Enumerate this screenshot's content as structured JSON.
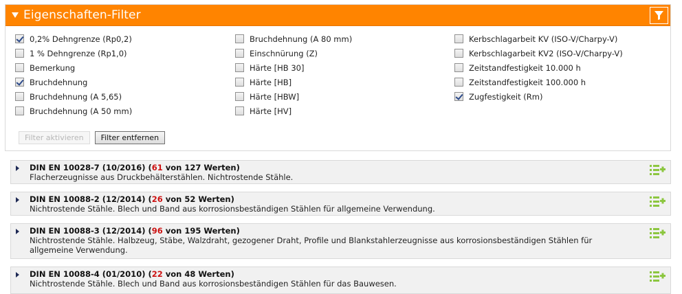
{
  "panel": {
    "title": "Eigenschaften-Filter",
    "icons": {
      "toggle": "triangle-down-icon",
      "filter": "funnel-icon"
    },
    "colors": {
      "header": "#ff8400",
      "highlight": "#cc1111",
      "add_icon": "#8cc63f"
    }
  },
  "columns": [
    [
      {
        "label": "0,2% Dehngrenze (Rp0,2)",
        "checked": true
      },
      {
        "label": "1 % Dehngrenze (Rp1,0)",
        "checked": false
      },
      {
        "label": "Bemerkung",
        "checked": false
      },
      {
        "label": "Bruchdehnung",
        "checked": true
      },
      {
        "label": "Bruchdehnung (A 5,65)",
        "checked": false
      },
      {
        "label": "Bruchdehnung (A 50 mm)",
        "checked": false
      }
    ],
    [
      {
        "label": "Bruchdehnung (A 80 mm)",
        "checked": false
      },
      {
        "label": "Einschnürung (Z)",
        "checked": false
      },
      {
        "label": "Härte [HB 30]",
        "checked": false
      },
      {
        "label": "Härte [HB]",
        "checked": false
      },
      {
        "label": "Härte [HBW]",
        "checked": false
      },
      {
        "label": "Härte [HV]",
        "checked": false
      }
    ],
    [
      {
        "label": "Kerbschlagarbeit KV (ISO-V/Charpy-V)",
        "checked": false
      },
      {
        "label": "Kerbschlagarbeit KV2 (ISO-V/Charpy-V)",
        "checked": false
      },
      {
        "label": "Zeitstandfestigkeit 10.000 h",
        "checked": false
      },
      {
        "label": "Zeitstandfestigkeit 100.000 h",
        "checked": false
      },
      {
        "label": "Zugfestigkeit (Rm)",
        "checked": true
      }
    ]
  ],
  "buttons": {
    "activate": "Filter aktivieren",
    "remove": "Filter entfernen"
  },
  "results": [
    {
      "title": "DIN EN 10028-7 (10/2016) (",
      "count": "61",
      "rest": " von 127 Werten)",
      "desc": "Flacherzeugnisse aus Druckbehälterstählen. Nichtrostende Stähle."
    },
    {
      "title": "DIN EN 10088-2 (12/2014) (",
      "count": "26",
      "rest": " von 52 Werten)",
      "desc": "Nichtrostende Stähle. Blech und Band aus korrosionsbeständigen Stählen für allgemeine Verwendung."
    },
    {
      "title": "DIN EN 10088-3 (12/2014) (",
      "count": "96",
      "rest": " von 195 Werten)",
      "desc": "Nichtrostende Stähle. Halbzeug, Stäbe, Walzdraht, gezogener Draht, Profile und Blankstahlerzeugnisse aus korrosionsbeständigen Stählen für allgemeine Verwendung."
    },
    {
      "title": "DIN EN 10088-4 (01/2010) (",
      "count": "22",
      "rest": " von 48 Werten)",
      "desc": "Nichtrostende Stähle. Blech und Band aus korrosionsbeständigen Stählen für das Bauwesen."
    }
  ]
}
